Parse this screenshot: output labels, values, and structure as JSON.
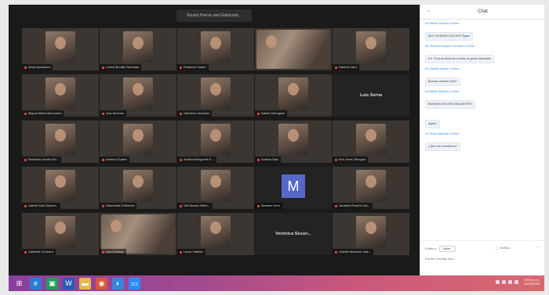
{
  "meeting": {
    "view_button_label": "Stuarts Pielcre and Galhicode...",
    "participants": [
      {
        "name": "Alma epicadonc",
        "kind": "video"
      },
      {
        "name": "Leilani Bundis Sernatas",
        "kind": "video"
      },
      {
        "name": "Emanuel Castro",
        "kind": "video"
      },
      {
        "name": "",
        "kind": "video-wide"
      },
      {
        "name": "Daniela Vara",
        "kind": "video"
      },
      {
        "name": "Miguel Alfaro Bermudez",
        "kind": "video"
      },
      {
        "name": "Ana Jimenez",
        "kind": "video"
      },
      {
        "name": "Gabriela Camacho",
        "kind": "video"
      },
      {
        "name": "Daniel Zeringues",
        "kind": "video"
      },
      {
        "name": "Luis Serna",
        "kind": "name"
      },
      {
        "name": "Reichelle Acosta Ro...",
        "kind": "video"
      },
      {
        "name": "Antonio Duarte",
        "kind": "video"
      },
      {
        "name": "Andrea Bringnerfl G...",
        "kind": "video"
      },
      {
        "name": "Andrea Diaz",
        "kind": "video"
      },
      {
        "name": "Eric Vives Obregon",
        "kind": "video"
      },
      {
        "name": "Valeria Soto Espino...",
        "kind": "video"
      },
      {
        "name": "Samantha Ontiveros",
        "kind": "video"
      },
      {
        "name": "Vivi Suarez Bedo...",
        "kind": "video"
      },
      {
        "name": "Mariana Vera",
        "kind": "avatar",
        "initial": "M"
      },
      {
        "name": "Jonaline Rosario Via...",
        "kind": "video"
      },
      {
        "name": "Gabriela Contrera",
        "kind": "video"
      },
      {
        "name": "Ana Ocampo",
        "kind": "video-wide"
      },
      {
        "name": "Laura Valfrida",
        "kind": "video"
      },
      {
        "name": "Verónica Sicuer...",
        "kind": "name"
      },
      {
        "name": "Lisbeth Mauricio Vale...",
        "kind": "video"
      }
    ]
  },
  "chat": {
    "title": "Chat",
    "messages": [
      {
        "from": "De Miriam Alarcon a Todos:",
        "text": "MUY BUENAS NOCHES Ågas!"
      },
      {
        "from": "De Verónica Vazquez Guzmán a Todos:",
        "text": "Co. Thomas Buenas noches un gusto saludarlo"
      },
      {
        "from": "De Claudia Valdez a Todos:",
        "text": "Buenas noches Gorin"
      },
      {
        "from": "De Miriam Alarcon a Todos:",
        "text": "BUENAS NOCHES MAGISTER!!"
      },
      {
        "from": "",
        "text": "Agas!!"
      },
      {
        "from": "De Jesus Valencia a Todos:",
        "text": "¿Qué me enseñaron?"
      }
    ],
    "to_label": "Enviar a:",
    "to_value": "Todos",
    "file_label": "Archivo",
    "input_placeholder": "Escribir mensaje aquí..."
  },
  "taskbar": {
    "clock_time": "09:24 p.m.",
    "clock_date": "02/06/2020",
    "accent": "#a14a8f"
  }
}
